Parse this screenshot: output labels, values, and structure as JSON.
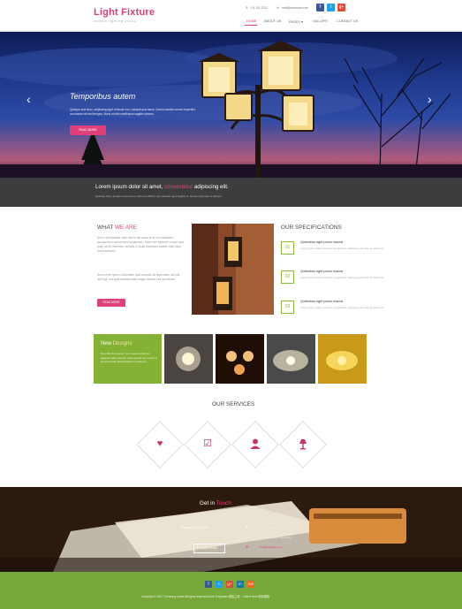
{
  "header": {
    "logo": "Light Fixture",
    "tagline": "modern lighting studio",
    "phone": "+11 111 2222",
    "email": "mail@example.com",
    "social": [
      "f",
      "t",
      "g+"
    ],
    "nav": [
      "HOME",
      "ABOUT US",
      "PAGES ▾",
      "GALLERY",
      "CONTACT US"
    ]
  },
  "hero": {
    "title": "Temporibus autem",
    "text": "Quisque sed nunc, adipiscing eget vehicula non, volutpat quis lacus. Donec lobortis ornare imperdiet accumsan vel sed tempus. Nunc et nibh vestibulum sagittis ultrices.",
    "button": "READ MORE",
    "prev": "‹",
    "next": "›"
  },
  "strip": {
    "title_pre": "Lorem ipsum dolor sit amet,",
    "title_hl": "consectetur",
    "title_post": "adipiscing elit.",
    "sub": "Quisque tortor semper elementum velit sed efficitur, vel molestie eget sagittis ut. Donec imperdiet ut ultrices."
  },
  "about": {
    "head_pre": "WHAT",
    "head_hl": "WE ARE",
    "para1": "Sed ut perspiciatis unde omnis iste natus error sit voluptatem accusantium doloremque laudantium, totam rem aperiam, eaque ipsa quae ab illo inventore veritatis et quasi architecto beatae vitae dicta sunt explicabo.",
    "para2": "Nemo enim ipsam voluptatem quia voluptas sit aspernatur aut odit aut fugit, sed quia consequuntur magni dolores eos qui ratione.",
    "button": "READ MORE"
  },
  "specs": {
    "head": "OUR SPECIFICATIONS",
    "items": [
      {
        "num": "01",
        "title": "Quisedius eget purus mauris",
        "text": "Lorem ipsum dolor sit amet consectetur adipiscing elit sed do eiusmod."
      },
      {
        "num": "02",
        "title": "Quisedius eget purus mauris",
        "text": "Lorem ipsum dolor sit amet consectetur adipiscing elit sed do eiusmod."
      },
      {
        "num": "03",
        "title": "Quisedius eget purus mauris",
        "text": "Lorem ipsum dolor sit amet consectetur adipiscing elit sed do eiusmod."
      }
    ]
  },
  "gallery": {
    "head_pre": "New",
    "head_hl": "Designs",
    "text": "Nam libero tempore, cum soluta nobis est eligendi optio cumque nihil impedit quo minus id quod maxime placeat facere possimus."
  },
  "services": {
    "head": "OUR SERVICES",
    "icons": [
      "heart-icon",
      "checkbox-icon",
      "user-icon",
      "lamp-icon"
    ]
  },
  "contact": {
    "head_pre": "Get in",
    "head_hl": "Touch",
    "label": "Ready to Buy us?",
    "button": "READ MORE",
    "lines": [
      "+11 111 2222 333",
      "123 Main Street, City Name",
      "mail@example.com"
    ]
  },
  "footer": {
    "social": [
      "f",
      "t",
      "g+",
      "in",
      "rss"
    ],
    "copyright": "Copyright © 2017 Company name All rights reserved.More Templates 模板之家 - Collect from 网页模板"
  },
  "colors": {
    "accent": "#e0407a",
    "green": "#76a83a",
    "strip": "#3d3d3d"
  }
}
